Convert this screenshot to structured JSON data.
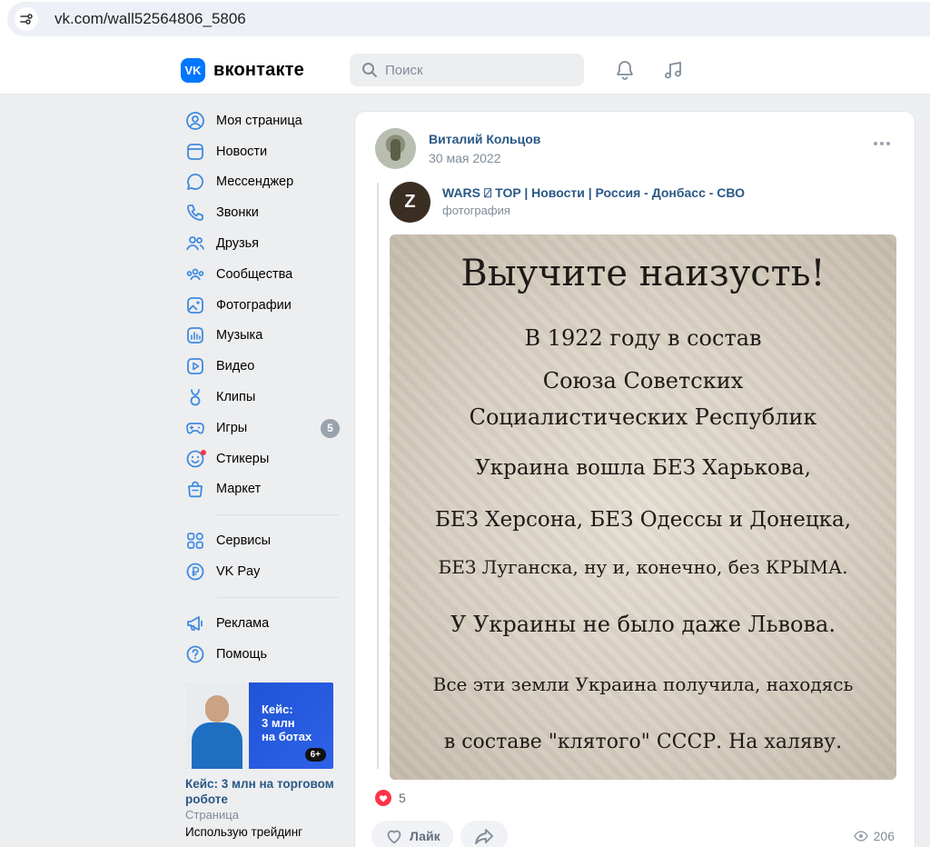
{
  "browser": {
    "url": "vk.com/wall52564806_5806"
  },
  "header": {
    "logo_mark": "VK",
    "logo_text": "вконтакте",
    "search_placeholder": "Поиск"
  },
  "sidebar": {
    "items": [
      {
        "label": "Моя страница",
        "icon": "user-circle-icon"
      },
      {
        "label": "Новости",
        "icon": "news-icon"
      },
      {
        "label": "Мессенджер",
        "icon": "chat-bubble-icon"
      },
      {
        "label": "Звонки",
        "icon": "phone-icon"
      },
      {
        "label": "Друзья",
        "icon": "friends-icon"
      },
      {
        "label": "Сообщества",
        "icon": "communities-icon"
      },
      {
        "label": "Фотографии",
        "icon": "photo-icon"
      },
      {
        "label": "Музыка",
        "icon": "music-icon"
      },
      {
        "label": "Видео",
        "icon": "video-icon"
      },
      {
        "label": "Клипы",
        "icon": "clips-icon"
      },
      {
        "label": "Игры",
        "icon": "gamepad-icon",
        "badge": "5"
      },
      {
        "label": "Стикеры",
        "icon": "sticker-smile-icon"
      },
      {
        "label": "Маркет",
        "icon": "market-bag-icon"
      }
    ],
    "items2": [
      {
        "label": "Сервисы",
        "icon": "services-grid-icon"
      },
      {
        "label": "VK Pay",
        "icon": "vkpay-ruble-icon"
      }
    ],
    "items3": [
      {
        "label": "Реклама",
        "icon": "megaphone-icon"
      },
      {
        "label": "Помощь",
        "icon": "help-icon"
      }
    ],
    "ad": {
      "image_caption_1": "Кейс:",
      "image_caption_2": "3 млн",
      "image_caption_3": "на ботах",
      "age_badge": "6+",
      "title": "Кейс: 3 млн на торговом роботе",
      "type": "Страница",
      "description": "Использую трейдинг"
    }
  },
  "post": {
    "author": "Виталий Кольцов",
    "date": "30 мая 2022",
    "source_avatar_letter": "Z",
    "source_name": "WARS ⍁ TOP | Новости | Россия - Донбасс - СВО",
    "source_type": "фотография",
    "image_text": [
      "Выучите наизусть!",
      "В 1922 году в состав",
      "Союза Советских",
      "Социалистических Республик",
      "Украина вошла БЕЗ Харькова,",
      "БЕЗ Херсона, БЕЗ Одессы и Донецка,",
      "БЕЗ Луганска, ну и, конечно, без КРЫМА.",
      "У Украины не было даже Львова.",
      "Все эти земли Украина получила, находясь",
      "в составе \"клятого\" СССР. На халяву."
    ],
    "likes_count": "5",
    "like_label": "Лайк",
    "views_count": "206"
  },
  "colors": {
    "accent": "#0077ff",
    "link": "#2a5885",
    "muted": "#818c99",
    "like_red": "#ff3347"
  }
}
